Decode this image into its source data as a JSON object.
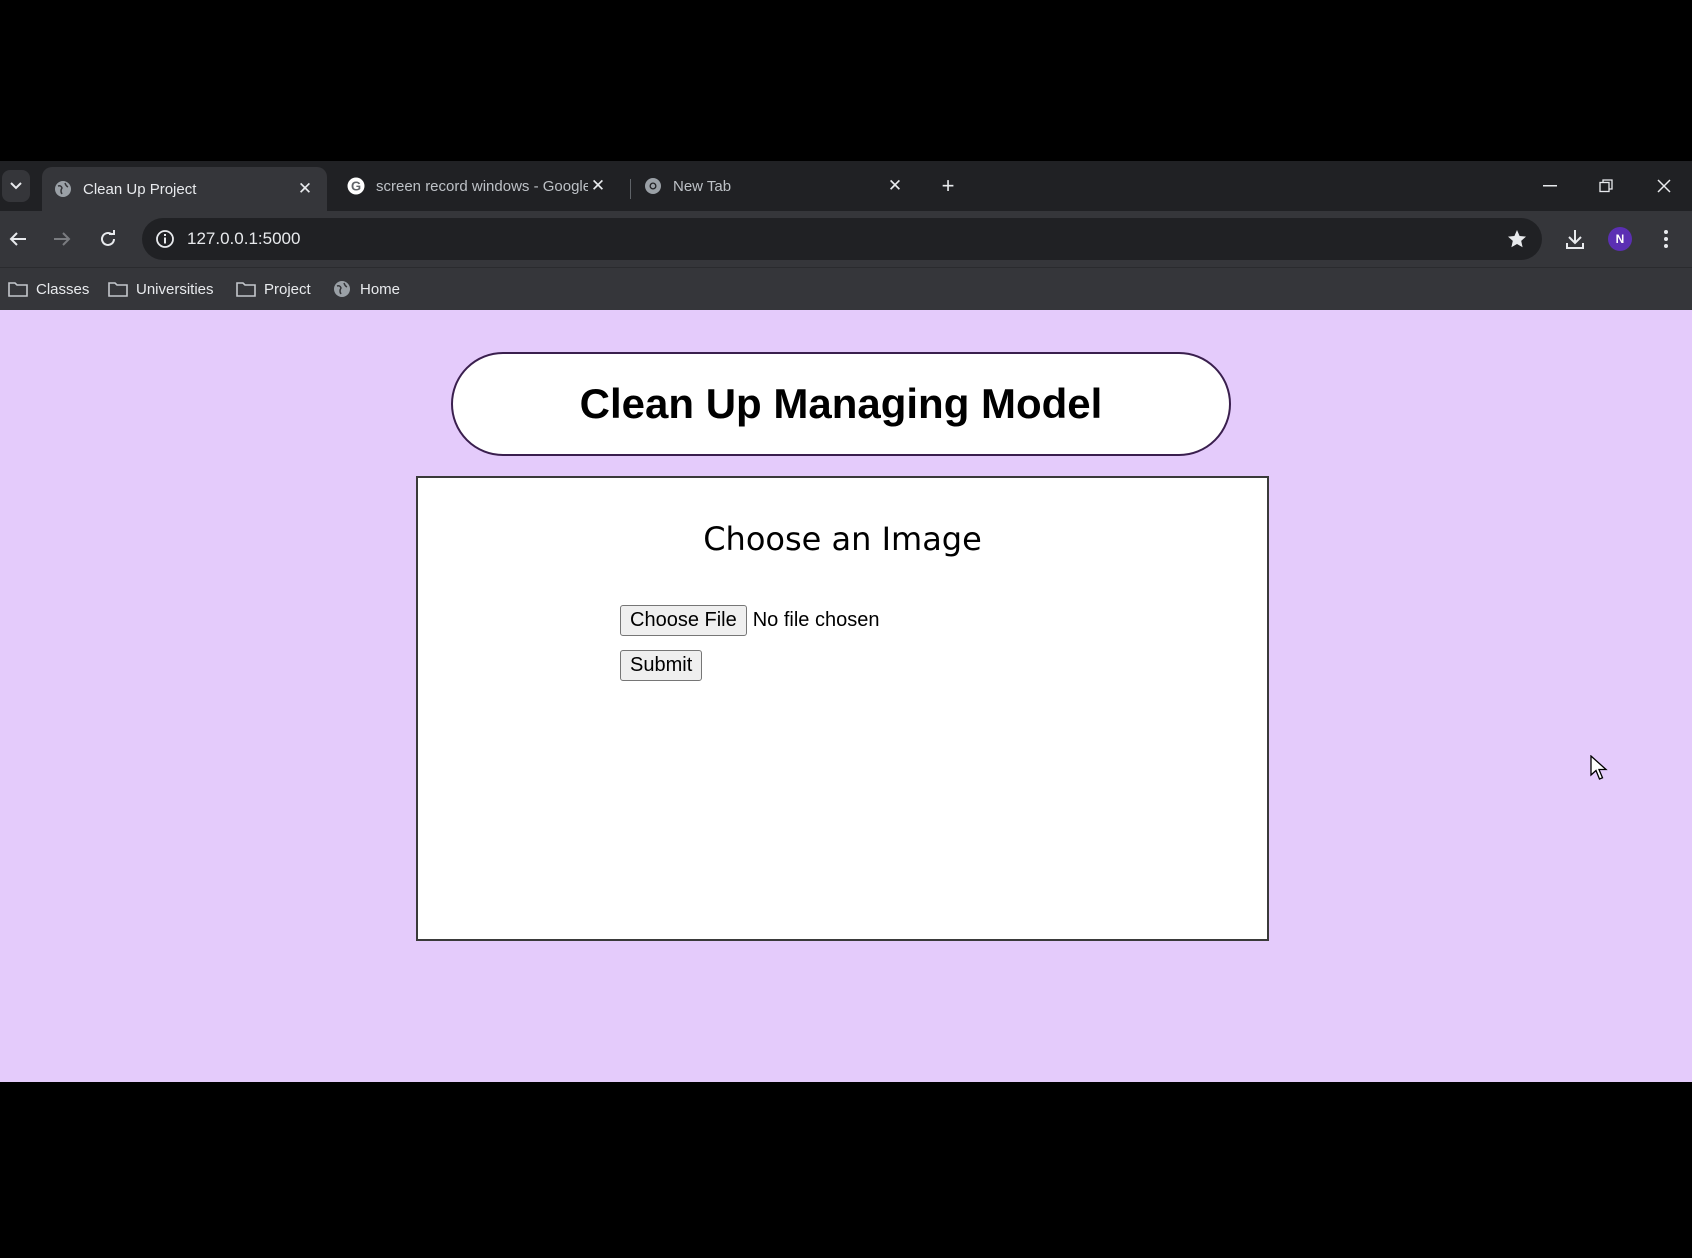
{
  "browser": {
    "tabs": [
      {
        "title": "Clean Up Project",
        "active": true,
        "favicon": "globe-icon"
      },
      {
        "title": "screen record windows - Google Search",
        "active": false,
        "favicon": "google-g-icon"
      },
      {
        "title": "New Tab",
        "active": false,
        "favicon": "chrome-icon"
      }
    ],
    "address": {
      "url": "127.0.0.1:5000"
    },
    "profile_initial": "N",
    "bookmarks": [
      {
        "label": "Classes",
        "icon": "folder-icon"
      },
      {
        "label": "Universities",
        "icon": "folder-icon"
      },
      {
        "label": "Project",
        "icon": "folder-icon"
      },
      {
        "label": "Home",
        "icon": "globe-icon"
      }
    ]
  },
  "page": {
    "title": "Clean Up Managing Model",
    "form": {
      "heading": "Choose an Image",
      "choose_file_label": "Choose File",
      "file_status": "No file chosen",
      "submit_label": "Submit"
    },
    "colors": {
      "background": "#e4cbfb",
      "card": "#ffffff"
    }
  }
}
